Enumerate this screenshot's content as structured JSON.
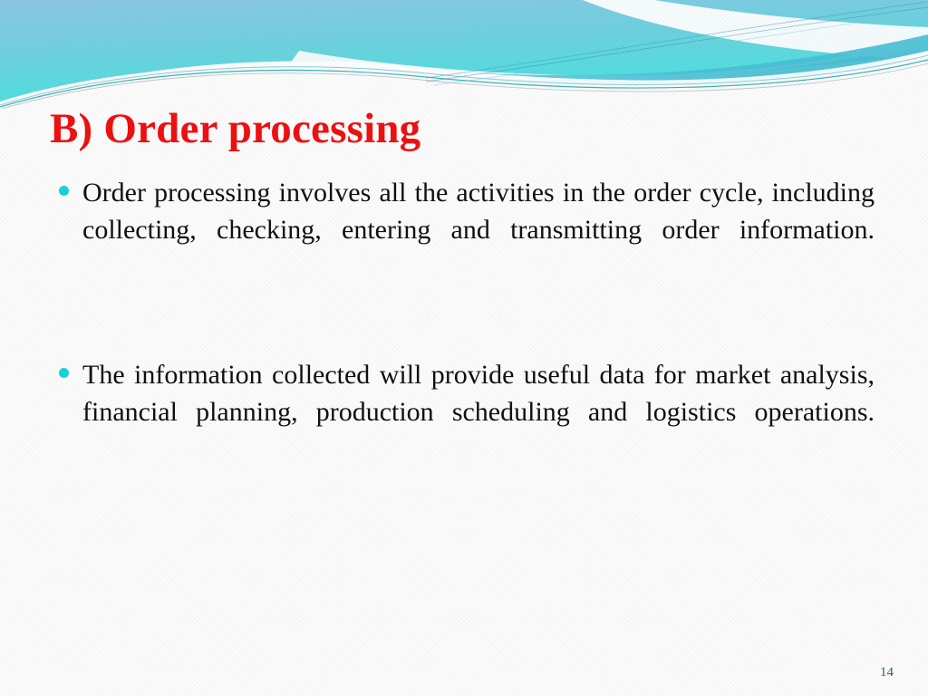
{
  "slide": {
    "title": "B) Order processing",
    "title_color": "#ee1111",
    "background_color": "#fbfbfb",
    "body_text_color": "#111111",
    "bullet_color": "#17d3d9",
    "page_number": "14",
    "page_number_color": "#2e5f63"
  },
  "banner": {
    "name": "decorative-wave-banner",
    "gradient_top": "#8ec7e6",
    "gradient_mid": "#6fd3de",
    "gradient_bottom": "#49e3e0",
    "accent_teal": "#1aa7a0",
    "accent_blue": "#5bb8d8",
    "accent_gray": "#9aa6ab"
  },
  "bullets": [
    {
      "id": "bullet-order-processing-definition",
      "text": "Order processing involves all the activities in the order cycle, including collecting, checking, entering and transmitting order information."
    },
    {
      "id": "bullet-information-use",
      "text": "The information collected will provide useful data for market analysis, financial planning, production scheduling and logistics operations."
    }
  ]
}
